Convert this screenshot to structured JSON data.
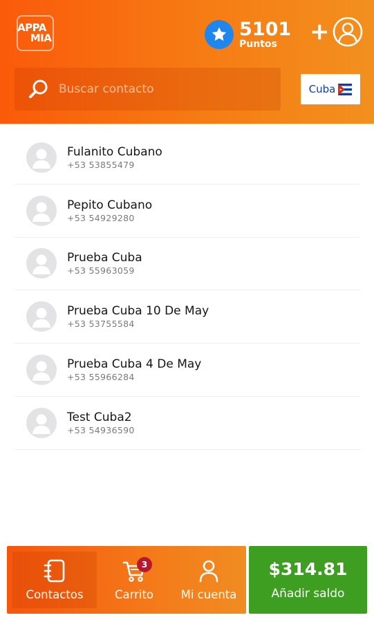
{
  "header": {
    "logo": {
      "line1": "APPA",
      "line2": "MIA"
    },
    "points": {
      "value": "5101",
      "label": "Puntos",
      "icon": "star-icon"
    },
    "add_contact_icon": "add-user-icon",
    "search": {
      "placeholder": "Buscar contacto",
      "icon": "search-icon"
    },
    "country": {
      "label": "Cuba",
      "flag": "cuba-flag-icon"
    }
  },
  "contacts": [
    {
      "name": "Fulanito Cubano",
      "phone": "+53 53855479"
    },
    {
      "name": "Pepito Cubano",
      "phone": "+53 54929280"
    },
    {
      "name": "Prueba Cuba",
      "phone": "+53 55963059"
    },
    {
      "name": "Prueba Cuba 10 De May",
      "phone": "+53 53755584"
    },
    {
      "name": "Prueba Cuba 4 De May",
      "phone": "+53 55966284"
    },
    {
      "name": "Test Cuba2",
      "phone": "+53 54936590"
    }
  ],
  "bottom_nav": {
    "items": [
      {
        "label": "Contactos",
        "icon": "contacts-icon",
        "active": true
      },
      {
        "label": "Carrito",
        "icon": "cart-icon",
        "badge": "3"
      },
      {
        "label": "Mi cuenta",
        "icon": "account-icon"
      }
    ]
  },
  "balance": {
    "amount": "$314.81",
    "label": "Añadir saldo"
  },
  "colors": {
    "header_start": "#fa5a0a",
    "header_end": "#f2901e",
    "star_blue": "#1f86ee",
    "balance_green": "#3e9e21",
    "badge_red": "#b8182d"
  }
}
